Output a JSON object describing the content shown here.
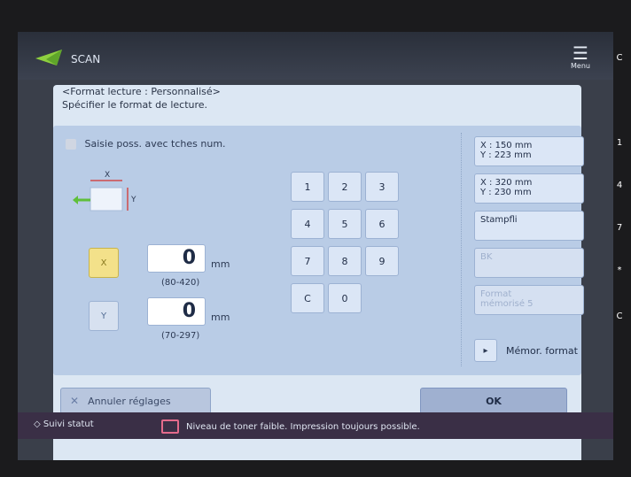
{
  "header": {
    "app_title": "SCAN",
    "menu_label": "Menu",
    "menu_icon": "menu-icon"
  },
  "instructions": {
    "line1": "<Format lecture : Personnalisé>",
    "line2": "Spécifier le format de lecture."
  },
  "hint": {
    "text": "Saisie poss. avec tches num."
  },
  "diagram": {
    "x_label": "X",
    "y_label": "Y"
  },
  "fields": {
    "x": {
      "button_label": "X",
      "value": "0",
      "unit": "mm",
      "range": "(80-420)"
    },
    "y": {
      "button_label": "Y",
      "value": "0",
      "unit": "mm",
      "range": "(70-297)"
    }
  },
  "keypad": {
    "keys": [
      "1",
      "2",
      "3",
      "4",
      "5",
      "6",
      "7",
      "8",
      "9",
      "C",
      "0"
    ]
  },
  "presets": [
    {
      "line1": "X : 150 mm",
      "line2": "Y : 223 mm",
      "enabled": true
    },
    {
      "line1": "X : 320 mm",
      "line2": "Y : 230 mm",
      "enabled": true
    },
    {
      "line1": "Stampfli",
      "line2": "",
      "enabled": true
    },
    {
      "line1": "BK",
      "line2": "",
      "enabled": false
    },
    {
      "line1": "Format",
      "line2": "mémorisé 5",
      "enabled": false
    }
  ],
  "memorize": {
    "label": "Mémor. format"
  },
  "buttons": {
    "cancel": "Annuler réglages",
    "ok": "OK"
  },
  "status": {
    "left": "Suivi statut",
    "message": "Niveau de toner faible. Impression toujours possible."
  },
  "right_sidebar": {
    "item1": "C",
    "item2": "1",
    "item3": "4",
    "item4": "7",
    "item5": "*",
    "item6": "C"
  }
}
